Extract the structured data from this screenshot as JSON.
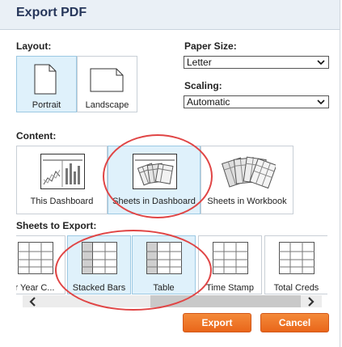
{
  "dialog": {
    "title": "Export PDF",
    "layout": {
      "label": "Layout:",
      "options": [
        {
          "label": "Portrait",
          "selected": true,
          "icon": "portrait-page-icon"
        },
        {
          "label": "Landscape",
          "selected": false,
          "icon": "landscape-page-icon"
        }
      ]
    },
    "paper_size": {
      "label": "Paper Size:",
      "value": "Letter"
    },
    "scaling": {
      "label": "Scaling:",
      "value": "Automatic"
    },
    "content": {
      "label": "Content:",
      "options": [
        {
          "label": "This Dashboard",
          "selected": false,
          "icon": "dashboard-thumbnail-icon"
        },
        {
          "label": "Sheets in Dashboard",
          "selected": true,
          "icon": "sheets-in-dashboard-icon"
        },
        {
          "label": "Sheets in Workbook",
          "selected": false,
          "icon": "sheets-in-workbook-icon"
        }
      ]
    },
    "sheets_to_export": {
      "label": "Sheets to Export:",
      "items": [
        {
          "label": "r Year C...",
          "selected": false
        },
        {
          "label": "Stacked Bars",
          "selected": true
        },
        {
          "label": "Table",
          "selected": true
        },
        {
          "label": "Time Stamp",
          "selected": false
        },
        {
          "label": "Total Creds",
          "selected": false
        }
      ]
    },
    "buttons": {
      "export": "Export",
      "cancel": "Cancel"
    },
    "colors": {
      "accent_orange": "#ee7a2a",
      "selected_bg": "#dff1fb",
      "annotation_red": "#e04545",
      "title_color": "#26365a"
    }
  }
}
